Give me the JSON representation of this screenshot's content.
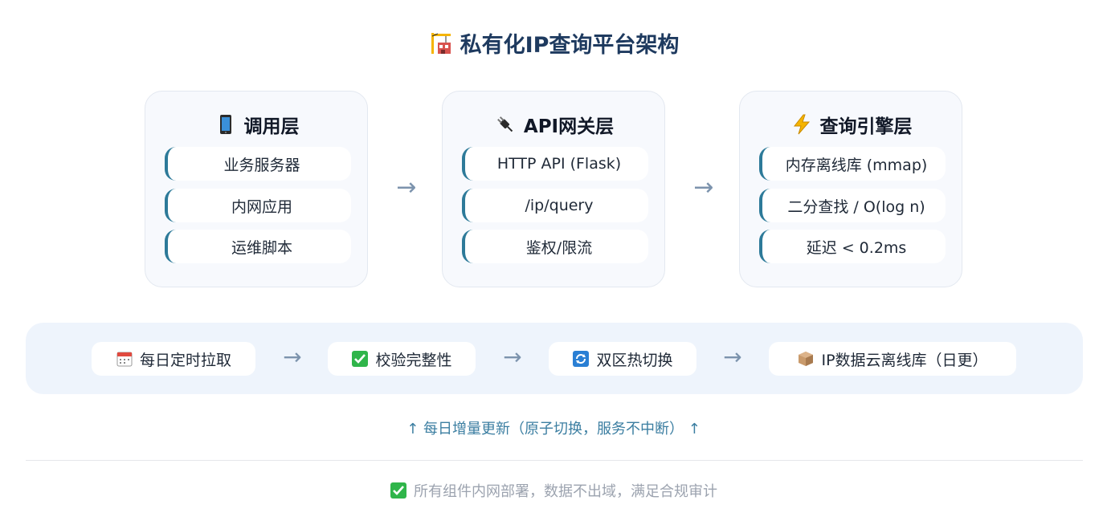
{
  "title": "私有化IP查询平台架构",
  "layers": [
    {
      "title": "调用层",
      "icon": "mobile-phone-icon",
      "items": [
        "业务服务器",
        "内网应用",
        "运维脚本"
      ]
    },
    {
      "title": "API网关层",
      "icon": "plug-icon",
      "items": [
        "HTTP API (Flask)",
        "/ip/query",
        "鉴权/限流"
      ]
    },
    {
      "title": "查询引擎层",
      "icon": "lightning-icon",
      "items": [
        "内存离线库 (mmap)",
        "二分查找 / O(log n)",
        "延迟 < 0.2ms"
      ]
    }
  ],
  "arrow": "→",
  "pipeline": [
    {
      "label": "每日定时拉取",
      "icon": "calendar-icon"
    },
    {
      "label": "校验完整性",
      "icon": "check-box-icon"
    },
    {
      "label": "双区热切换",
      "icon": "refresh-icon"
    },
    {
      "label": "IP数据云离线库（日更）",
      "icon": "package-icon"
    }
  ],
  "update_note": "↑ 每日增量更新（原子切换，服务不中断） ↑",
  "footer": "所有组件内网部署，数据不出域，满足合规审计",
  "colors": {
    "title": "#1e3a5f",
    "accent": "#2d7a99",
    "card_bg": "#f7f9fd",
    "pipeline_bg": "#eef4fc",
    "arrow": "#7c93ad",
    "note": "#3b7ea1",
    "footer": "#9ca3af"
  }
}
